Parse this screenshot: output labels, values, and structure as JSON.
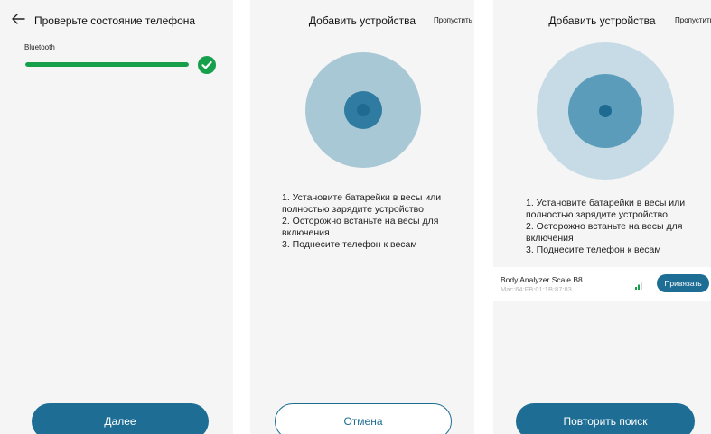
{
  "screen1": {
    "title": "Проверьте состояние телефона",
    "bluetooth_label": "Bluetooth",
    "bluetooth_progress": 1.0,
    "next_button": "Далее"
  },
  "screen2": {
    "title": "Добавить устройства",
    "skip": "Пропустить",
    "steps": [
      "1. Установите батарейки в весы или",
      "полностью зарядите устройство",
      "2. Осторожно встаньте на весы для",
      "включения",
      "3. Поднесите телефон к весам"
    ],
    "cancel_button": "Отмена"
  },
  "screen3": {
    "title": "Добавить устройства",
    "skip": "Пропустить",
    "steps": [
      "1. Установите батарейки в весы или",
      "полностью зарядите устройство",
      "2. Осторожно встаньте на весы для",
      "включения",
      "3. Поднесите телефон к весам"
    ],
    "device": {
      "name": "Body Analyzer Scale B8",
      "mac": "Mac:64:FB:01:1B:87:83",
      "bind_button": "Привязать"
    },
    "retry_button": "Повторить поиск"
  },
  "colors": {
    "accent": "#1e6d94",
    "success": "#17a04c",
    "ring_outer_2": "#a9c8d6",
    "ring_inner_2": "#2f7ba1",
    "ring_outer_3": "#c7dbe6",
    "ring_mid_3": "#5a9cba",
    "dot": "#1f6a91"
  }
}
